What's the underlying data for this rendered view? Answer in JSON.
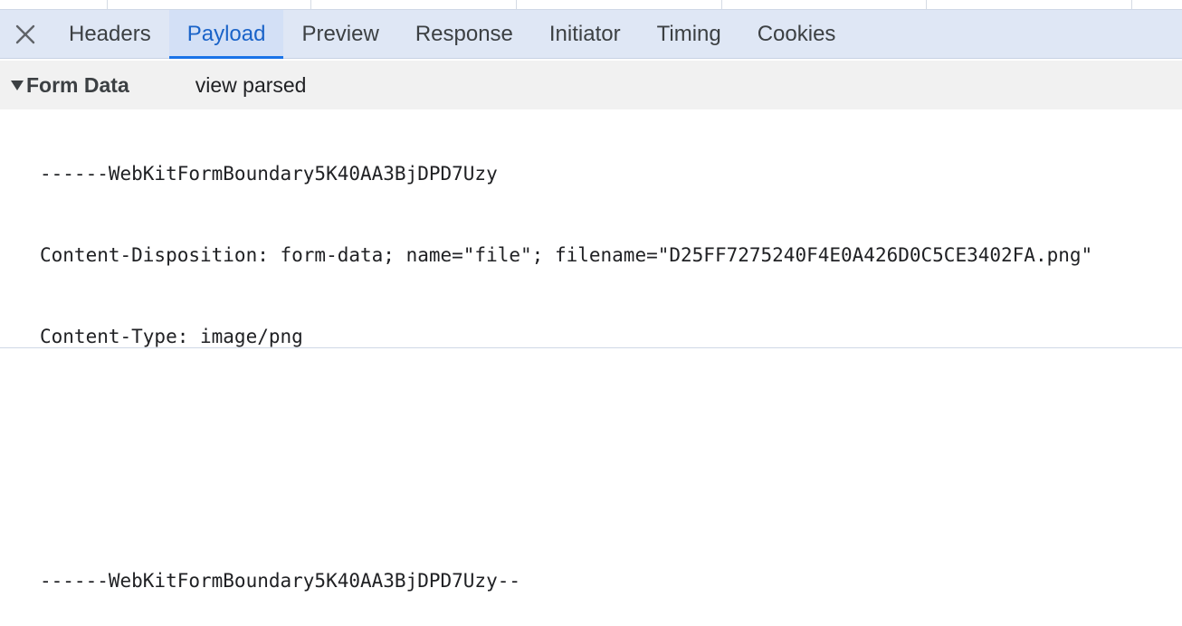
{
  "tabs": [
    {
      "label": "Headers",
      "active": false
    },
    {
      "label": "Payload",
      "active": true
    },
    {
      "label": "Preview",
      "active": false
    },
    {
      "label": "Response",
      "active": false
    },
    {
      "label": "Initiator",
      "active": false
    },
    {
      "label": "Timing",
      "active": false
    },
    {
      "label": "Cookies",
      "active": false
    }
  ],
  "close_icon": "close-icon",
  "section": {
    "title": "Form Data",
    "view_parsed_label": "view parsed",
    "expanded": true
  },
  "payload_lines": [
    "------WebKitFormBoundary5K40AA3BjDPD7Uzy",
    "Content-Disposition: form-data; name=\"file\"; filename=\"D25FF7275240F4E0A426D0C5CE3402FA.png\"",
    "Content-Type: image/png",
    "",
    "",
    "------WebKitFormBoundary5K40AA3BjDPD7Uzy--"
  ],
  "colors": {
    "tabbar_bg": "#dfe7f5",
    "active_tab_text": "#1a63c8",
    "active_tab_indicator": "#1a73e8",
    "section_bg": "#f1f1f1"
  }
}
